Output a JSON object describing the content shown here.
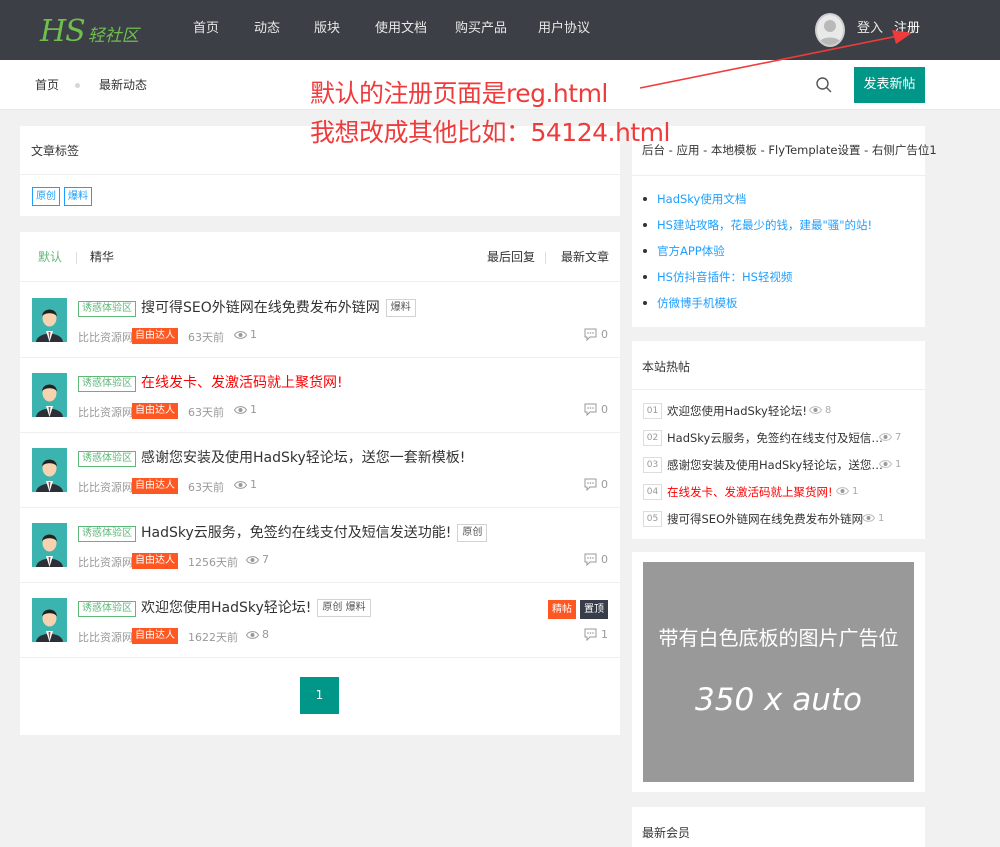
{
  "logo": {
    "main": "HS",
    "sub": "轻社区"
  },
  "nav": [
    "首页",
    "动态",
    "版块",
    "使用文档",
    "购买产品",
    "用户协议"
  ],
  "user": {
    "login": "登入",
    "register": "注册"
  },
  "breadcrumb": {
    "home": "首页",
    "current": "最新动态"
  },
  "post_button": "发表新帖",
  "annotation": {
    "line1": "默认的注册页面是reg.html",
    "line2": "我想改成其他比如：54124.html",
    "color": "#ef3b3b"
  },
  "tags_panel": {
    "title": "文章标签",
    "tags": [
      "原创",
      "爆料"
    ]
  },
  "tabs": {
    "left": [
      "默认",
      "精华"
    ],
    "right": [
      "最后回复",
      "最新文章"
    ]
  },
  "threads": [
    {
      "zone": "诱惑体验区",
      "title": "搜可得SEO外链网在线免费发布外链网",
      "title_red": false,
      "tags": "爆料",
      "source": "比比资源网",
      "badge": "自由达人",
      "time": "63天前",
      "views": "1",
      "replies": "0",
      "labels": []
    },
    {
      "zone": "诱惑体验区",
      "title": "在线发卡、发激活码就上聚货网!",
      "title_red": true,
      "tags": "",
      "source": "比比资源网",
      "badge": "自由达人",
      "time": "63天前",
      "views": "1",
      "replies": "0",
      "labels": []
    },
    {
      "zone": "诱惑体验区",
      "title": "感谢您安装及使用HadSky轻论坛，送您一套新模板!",
      "title_red": false,
      "tags": "",
      "source": "比比资源网",
      "badge": "自由达人",
      "time": "63天前",
      "views": "1",
      "replies": "0",
      "labels": []
    },
    {
      "zone": "诱惑体验区",
      "title": "HadSky云服务，免签约在线支付及短信发送功能!",
      "title_red": false,
      "tags": "原创",
      "source": "比比资源网",
      "badge": "自由达人",
      "time": "1256天前",
      "views": "7",
      "replies": "0",
      "labels": []
    },
    {
      "zone": "诱惑体验区",
      "title": "欢迎您使用HadSky轻论坛!",
      "title_red": false,
      "tags": "原创 爆料",
      "source": "比比资源网",
      "badge": "自由达人",
      "time": "1622天前",
      "views": "8",
      "replies": "1",
      "labels": [
        "精帖",
        "置顶"
      ]
    }
  ],
  "pagination": {
    "current": "1"
  },
  "side_ad_panel": {
    "title": "后台 - 应用 - 本地模板 - FlyTemplate设置 - 右侧广告位1",
    "links": [
      "HadSky使用文档",
      "HS建站攻略，花最少的钱，建最\"骚\"的站!",
      "官方APP体验",
      "HS仿抖音插件：HS轻视频",
      "仿微博手机模板"
    ]
  },
  "hot_panel": {
    "title": "本站热帖",
    "items": [
      {
        "num": "01",
        "title": "欢迎您使用HadSky轻论坛!",
        "views": "8",
        "red": false
      },
      {
        "num": "02",
        "title": "HadSky云服务，免签约在线支付及短信…",
        "views": "7",
        "red": false
      },
      {
        "num": "03",
        "title": "感谢您安装及使用HadSky轻论坛，送您…",
        "views": "1",
        "red": false
      },
      {
        "num": "04",
        "title": "在线发卡、发激活码就上聚货网!",
        "views": "1",
        "red": true
      },
      {
        "num": "05",
        "title": "搜可得SEO外链网在线免费发布外链网",
        "views": "1",
        "red": false
      }
    ]
  },
  "image_ad": {
    "line1": "带有白色底板的图片广告位",
    "line2": "350 x auto"
  },
  "members_panel": {
    "title": "最新会员"
  },
  "colors": {
    "accent": "#009688",
    "topbar": "#3c3f45",
    "badge": "#ff5722",
    "link": "#1e9fff",
    "zone": "#5fb878"
  }
}
